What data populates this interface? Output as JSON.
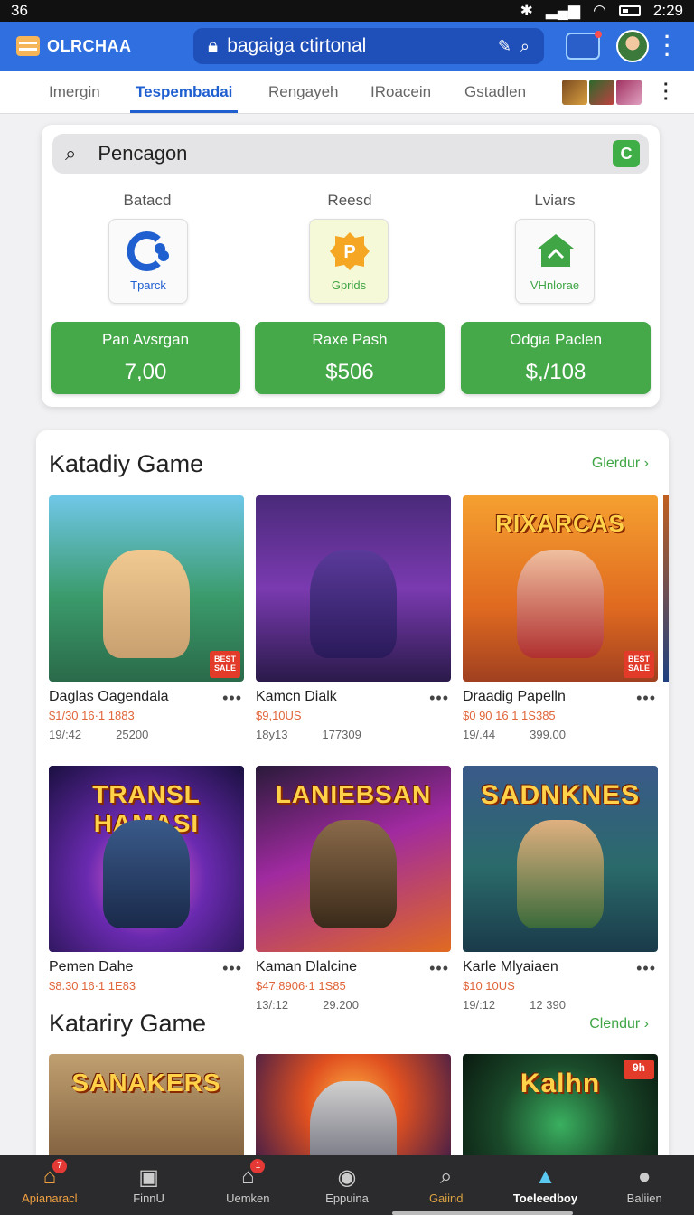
{
  "status_bar": {
    "left": "36",
    "time": "2:29"
  },
  "header": {
    "brand": "OLRCHAA",
    "url": "bagaiga ctirtonal"
  },
  "tabs": [
    {
      "label": "Imergin"
    },
    {
      "label": "Tespembadai",
      "active": true
    },
    {
      "label": "Rengayeh"
    },
    {
      "label": "IRoacein"
    },
    {
      "label": "Gstadlen"
    }
  ],
  "search": {
    "value": "Pencagon",
    "button": "C"
  },
  "shortcuts": [
    {
      "heading": "Batacd",
      "caption": "Tparck",
      "icon": "game-controller-icon",
      "color": "#1f5fd0"
    },
    {
      "heading": "Reesd",
      "caption": "Gprids",
      "icon": "puzzle-icon",
      "color": "#f5a623"
    },
    {
      "heading": "Lviars",
      "caption": "VHnlorae",
      "icon": "home-icon",
      "color": "#3fa545"
    }
  ],
  "stats": [
    {
      "label": "Pan Avsrgan",
      "value": "7,00"
    },
    {
      "label": "Raxe Pash",
      "value": "$506"
    },
    {
      "label": "Odgia Paclen",
      "value": "$,/108"
    }
  ],
  "sections": [
    {
      "title": "Katadiy Game",
      "more": "Glerdur"
    },
    {
      "title": "Katariry Game",
      "more": "Clendur"
    }
  ],
  "games_row1": [
    {
      "name": "Daglas Oagendala",
      "price": "$1/30 16·1 1883",
      "meta1": "19/:42",
      "meta2": "25200",
      "title_text": "",
      "badge": "BEST SALE"
    },
    {
      "name": "Kamcn Dialk",
      "price": "$9,10US",
      "meta1": "18y13",
      "meta2": "177309",
      "title_text": "",
      "badge": ""
    },
    {
      "name": "Draadig Papelln",
      "price": "$0 90 16 1 1S385",
      "meta1": "19/.44",
      "meta2": "399.00",
      "title_text": "RIXARCAS",
      "badge": "BEST SALE"
    }
  ],
  "games_row2": [
    {
      "name": "Pemen Dahe",
      "price": "$8.30 16·1 1E83",
      "title_text": "TRANSL HAMASI"
    },
    {
      "name": "Kaman Dlalcine",
      "price": "$47.8906·1 1S85",
      "meta1": "13/:12",
      "meta2": "29.200",
      "title_text": "LANIEBSAN"
    },
    {
      "name": "Karle Mlyaiaen",
      "price": "$10 10US",
      "meta1": "19/:12",
      "meta2": "12 390",
      "title_text": "SADNKNES"
    }
  ],
  "games_row3": [
    {
      "title_text": "SANAKERS"
    },
    {
      "title_text": ""
    },
    {
      "title_text": "Kalhn",
      "badge": "9h"
    }
  ],
  "bottom_nav": [
    {
      "label": "Apianaracl",
      "icon": "home-icon",
      "badge": "7"
    },
    {
      "label": "FinnU",
      "icon": "film-icon"
    },
    {
      "label": "Uemken",
      "icon": "bag-icon",
      "badge": "1"
    },
    {
      "label": "Eppuina",
      "icon": "compass-icon"
    },
    {
      "label": "Gaiind",
      "icon": "search-icon"
    },
    {
      "label": "Toeleedboy",
      "icon": "store-icon",
      "active": true
    },
    {
      "label": "Baliien",
      "icon": "person-icon"
    }
  ]
}
